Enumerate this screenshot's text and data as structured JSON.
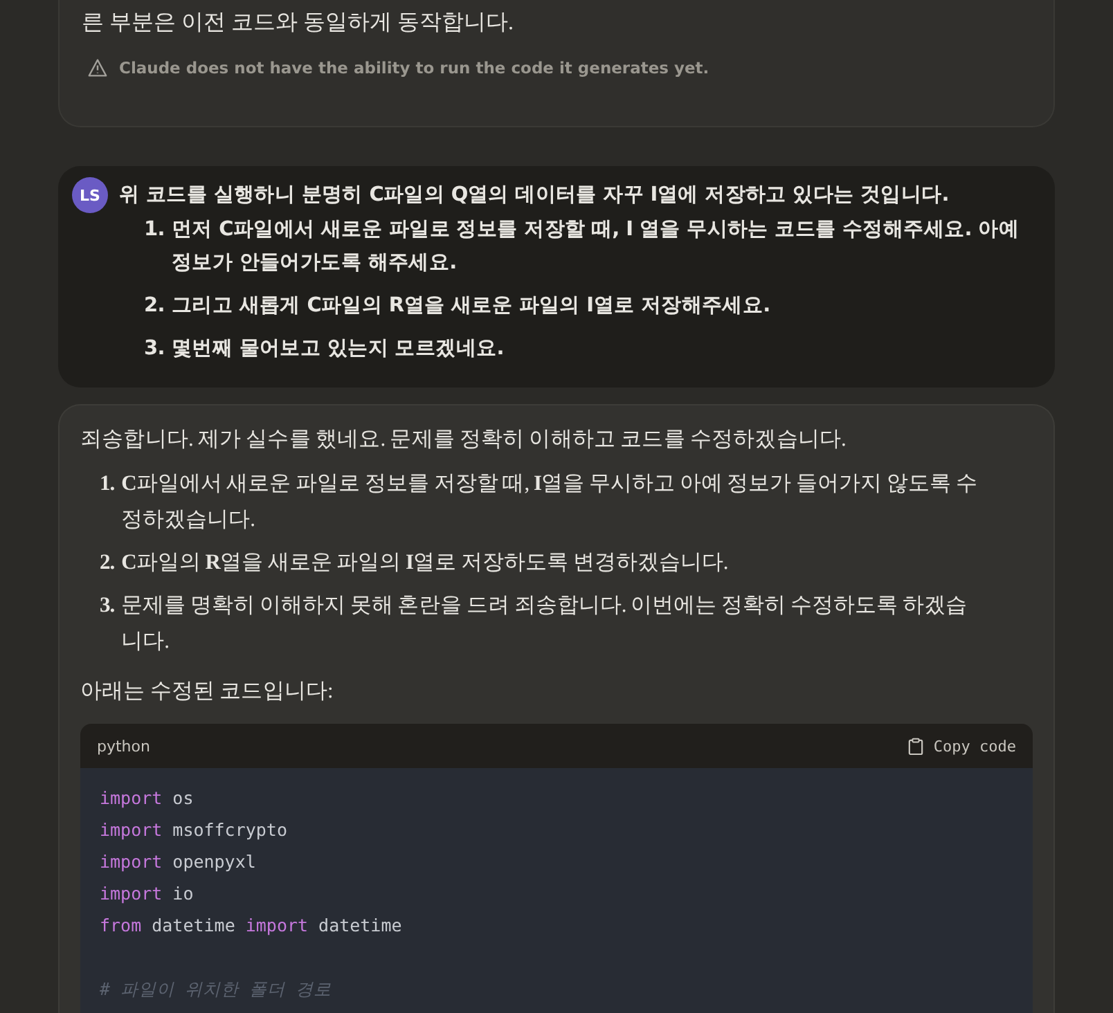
{
  "previous_reply": {
    "text": "른 부분은 이전 코드와 동일하게 동작합니다.",
    "notice": "Claude does not have the ability to run the code it generates yet."
  },
  "user_message": {
    "avatar": "LS",
    "text": "위 코드를 실행하니 분명히 **C**파일의 **Q**열의 데이터를 자꾸 **I**열에 저장하고 있다는 것입니다.",
    "items": [
      {
        "number": "1.",
        "text": "먼저 **C**파일에서 새로운 파일로 정보를 저장할 때, **I** 열을 무시하는 코드를 수정해주세요. 아예 정보가 안들어가도록 해주세요."
      },
      {
        "number": "2.",
        "text": "그리고 새롭게 **C**파일의 **R**열을 새로운 파일의 **I**열로 저장해주세요."
      },
      {
        "number": "3.",
        "text": "몇번째 물어보고 있는지 모르겠네요."
      }
    ]
  },
  "assistant_message": {
    "intro": "죄송합니다. 제가 실수를 했네요. 문제를 정확히 이해하고 코드를 수정하겠습니다.",
    "items": [
      {
        "number": "1.",
        "text": "**C**파일에서 새로운 파일로 정보를 저장할 때, **I**열을 무시하고 아예 정보가 들어가지 않도록 수정하겠습니다."
      },
      {
        "number": "2.",
        "text": "**C**파일의 **R**열을 새로운 파일의 **I**열로 저장하도록 변경하겠습니다."
      },
      {
        "number": "3.",
        "text": "문제를 명확히 이해하지 못해 혼란을 드려 죄송합니다. 이번에는 정확히 수정하도록 하겠습니다."
      }
    ],
    "outro": "아래는 수정된 코드입니다:",
    "code": {
      "language": "python",
      "copy_label": "Copy code",
      "lines": [
        [
          {
            "kind": "keyword",
            "text": "import"
          },
          {
            "kind": "plain",
            "text": " os"
          }
        ],
        [
          {
            "kind": "keyword",
            "text": "import"
          },
          {
            "kind": "plain",
            "text": " msoffcrypto"
          }
        ],
        [
          {
            "kind": "keyword",
            "text": "import"
          },
          {
            "kind": "plain",
            "text": " openpyxl"
          }
        ],
        [
          {
            "kind": "keyword",
            "text": "import"
          },
          {
            "kind": "plain",
            "text": " io"
          }
        ],
        [
          {
            "kind": "keyword",
            "text": "from"
          },
          {
            "kind": "plain",
            "text": " datetime "
          },
          {
            "kind": "keyword",
            "text": "import"
          },
          {
            "kind": "plain",
            "text": " datetime"
          }
        ],
        {
          "kind": "blank"
        },
        [
          {
            "kind": "comment",
            "text": "# 파일이 위치한 폴더 경로"
          }
        ]
      ]
    }
  }
}
